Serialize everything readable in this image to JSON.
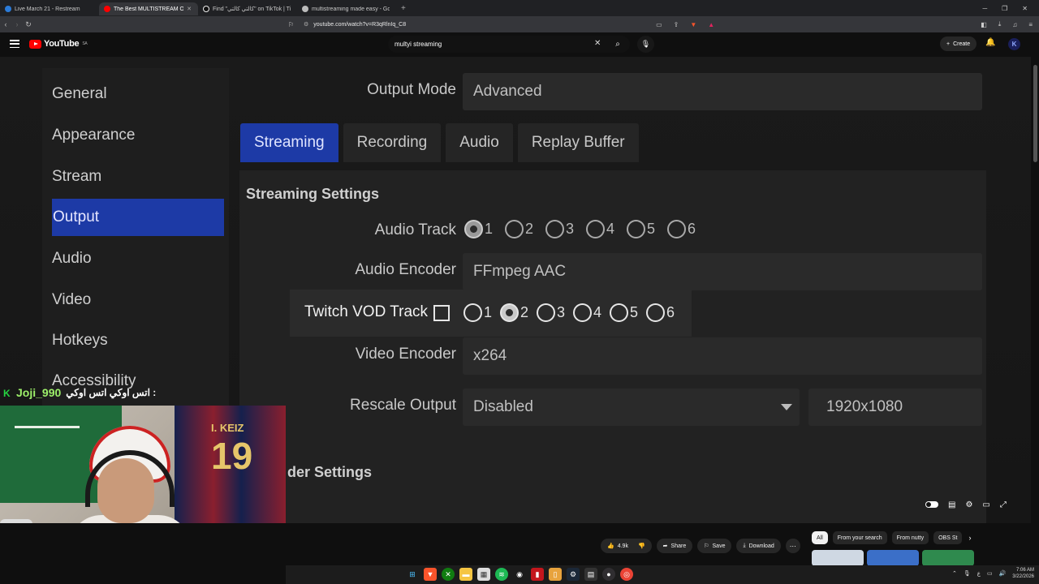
{
  "browser": {
    "tabs": [
      {
        "title": "Live March 21 - Restream",
        "color": "#2b7bd8",
        "active": false
      },
      {
        "title": "The Best MULTISTREAM OBS",
        "color": "#ff0000",
        "active": true
      },
      {
        "title": "Find \"كالتي كالتي\" on TikTok | TikTok",
        "color": "#eeeeee",
        "active": false
      },
      {
        "title": "multistreaming made easy - Google",
        "color": "#bbbbbb",
        "active": false
      }
    ],
    "url": "youtube.com/watch?v=R3qRlnIq_C8"
  },
  "youtube": {
    "logo_text": "YouTube",
    "region": "SA",
    "search_value": "multyi streaming",
    "create_label": "Create",
    "avatar_letter": "K"
  },
  "obs": {
    "sidebar": [
      "General",
      "Appearance",
      "Stream",
      "Output",
      "Audio",
      "Video",
      "Hotkeys",
      "Accessibility"
    ],
    "sidebar_selected": "Output",
    "output_mode_label": "Output Mode",
    "output_mode_value": "Advanced",
    "tabs": [
      "Streaming",
      "Recording",
      "Audio",
      "Replay Buffer"
    ],
    "selected_tab": "Streaming",
    "streaming_settings_title": "Streaming Settings",
    "audio_track_label": "Audio Track",
    "audio_track_options": [
      "1",
      "2",
      "3",
      "4",
      "5",
      "6"
    ],
    "audio_track_selected": "1",
    "audio_encoder_label": "Audio Encoder",
    "audio_encoder_value": "FFmpeg AAC",
    "twitch_label": "Twitch VOD Track",
    "twitch_options": [
      "1",
      "2",
      "3",
      "4",
      "5",
      "6"
    ],
    "twitch_selected": "2",
    "video_encoder_label": "Video Encoder",
    "video_encoder_value": "x264",
    "rescale_label": "Rescale Output",
    "rescale_value": "Disabled",
    "rescale_res": "1920x1080",
    "encoder_settings_partial": "der Settings"
  },
  "overlay": {
    "chat_user": "Joji_990",
    "chat_message": "اتس اوكي اتس اوكي :",
    "jersey_name": "I. KEIZ",
    "jersey_number": "19"
  },
  "actions": {
    "likes": "4.9k",
    "share": "Share",
    "save": "Save",
    "download": "Download"
  },
  "chips": [
    "All",
    "From your search",
    "From nutty",
    "OBS St"
  ],
  "clock": {
    "time": "7:06 AM",
    "date": "3/22/2026"
  }
}
